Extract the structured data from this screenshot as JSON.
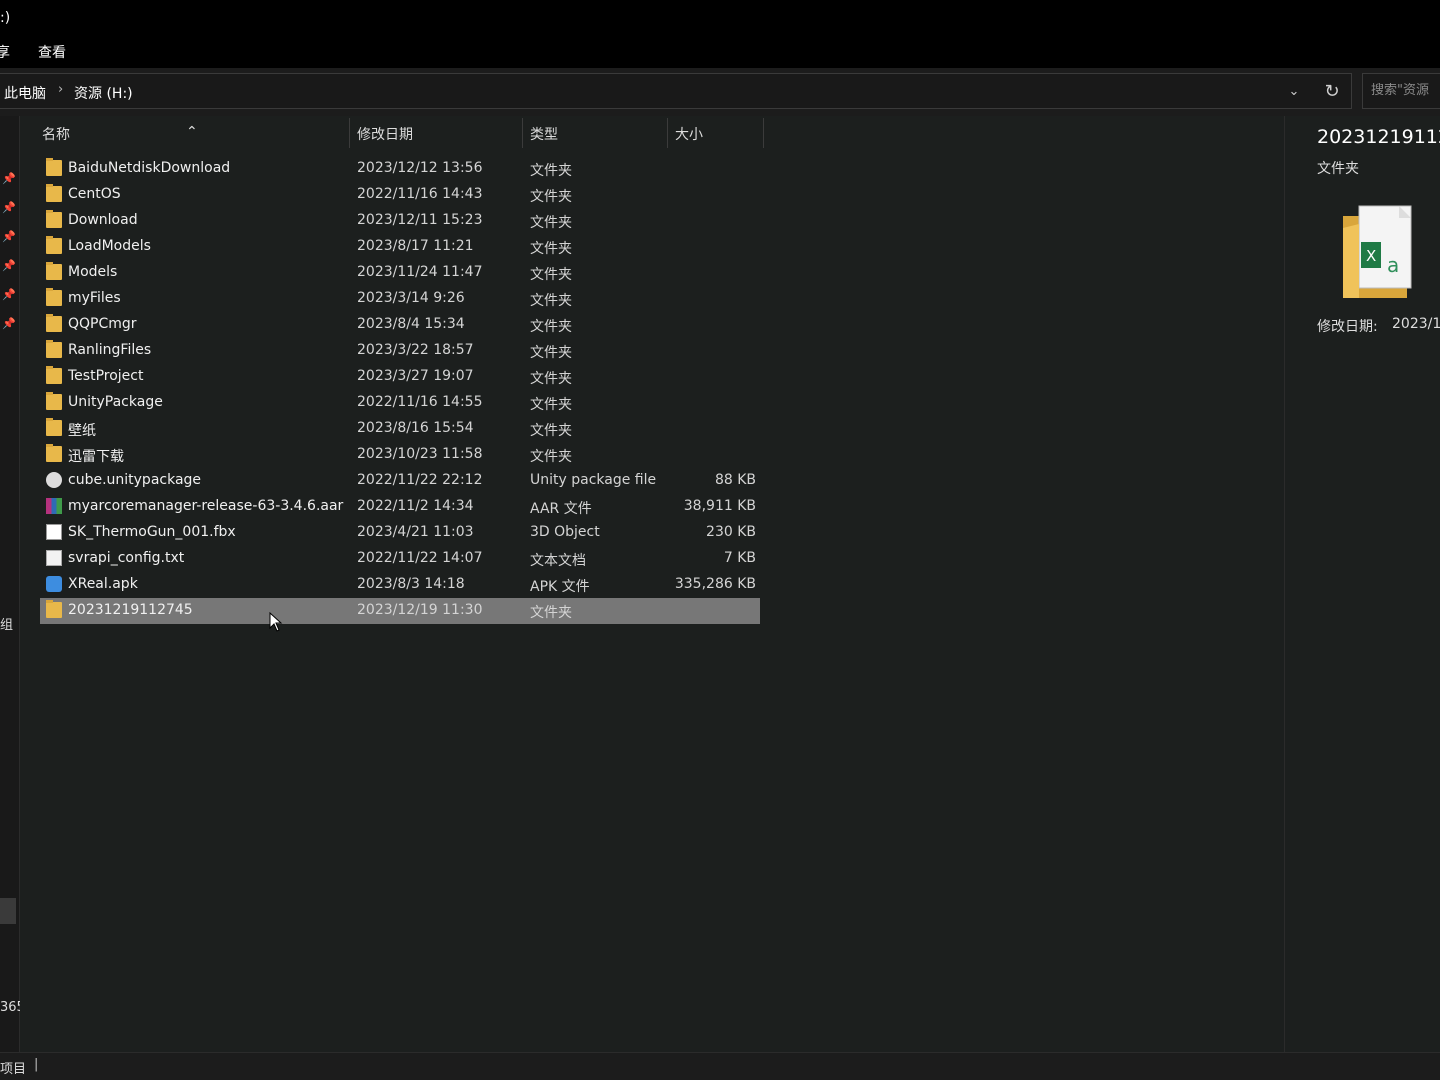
{
  "window": {
    "title": ":)"
  },
  "menu": {
    "items": [
      {
        "label": "享"
      },
      {
        "label": "查看"
      }
    ]
  },
  "address": {
    "crumbs": [
      {
        "label": "此电脑"
      },
      {
        "label": "资源 (H:)"
      }
    ],
    "separator": "›",
    "search_placeholder": "搜索\"资源"
  },
  "nav": {
    "group_label": "组",
    "count_label": "365"
  },
  "columns": {
    "name": "名称",
    "date": "修改日期",
    "type": "类型",
    "size": "大小"
  },
  "files": [
    {
      "name": "BaiduNetdiskDownload",
      "date": "2023/12/12 13:56",
      "type": "文件夹",
      "size": "",
      "icon": "folder-icon"
    },
    {
      "name": "CentOS",
      "date": "2022/11/16 14:43",
      "type": "文件夹",
      "size": "",
      "icon": "folder-icon"
    },
    {
      "name": "Download",
      "date": "2023/12/11 15:23",
      "type": "文件夹",
      "size": "",
      "icon": "folder-icon"
    },
    {
      "name": "LoadModels",
      "date": "2023/8/17 11:21",
      "type": "文件夹",
      "size": "",
      "icon": "folder-icon"
    },
    {
      "name": "Models",
      "date": "2023/11/24 11:47",
      "type": "文件夹",
      "size": "",
      "icon": "folder-icon"
    },
    {
      "name": "myFiles",
      "date": "2023/3/14 9:26",
      "type": "文件夹",
      "size": "",
      "icon": "folder-icon"
    },
    {
      "name": "QQPCmgr",
      "date": "2023/8/4 15:34",
      "type": "文件夹",
      "size": "",
      "icon": "folder-icon"
    },
    {
      "name": "RanlingFiles",
      "date": "2023/3/22 18:57",
      "type": "文件夹",
      "size": "",
      "icon": "folder-icon"
    },
    {
      "name": "TestProject",
      "date": "2023/3/27 19:07",
      "type": "文件夹",
      "size": "",
      "icon": "folder-icon"
    },
    {
      "name": "UnityPackage",
      "date": "2022/11/16 14:55",
      "type": "文件夹",
      "size": "",
      "icon": "folder-icon"
    },
    {
      "name": "壁纸",
      "date": "2023/8/16 15:54",
      "type": "文件夹",
      "size": "",
      "icon": "folder-icon"
    },
    {
      "name": "迅雷下载",
      "date": "2023/10/23 11:58",
      "type": "文件夹",
      "size": "",
      "icon": "folder-icon"
    },
    {
      "name": "cube.unitypackage",
      "date": "2022/11/22 22:12",
      "type": "Unity package file",
      "size": "88 KB",
      "icon": "unity-package-icon"
    },
    {
      "name": "myarcoremanager-release-63-3.4.6.aar",
      "date": "2022/11/2 14:34",
      "type": "AAR 文件",
      "size": "38,911 KB",
      "icon": "archive-icon"
    },
    {
      "name": "SK_ThermoGun_001.fbx",
      "date": "2023/4/21 11:03",
      "type": "3D Object",
      "size": "230 KB",
      "icon": "3d-object-icon"
    },
    {
      "name": "svrapi_config.txt",
      "date": "2022/11/22 14:07",
      "type": "文本文档",
      "size": "7 KB",
      "icon": "text-file-icon"
    },
    {
      "name": "XReal.apk",
      "date": "2023/8/3 14:18",
      "type": "APK 文件",
      "size": "335,286 KB",
      "icon": "apk-icon"
    },
    {
      "name": "20231219112745",
      "date": "2023/12/19 11:30",
      "type": "文件夹",
      "size": "",
      "icon": "folder-icon",
      "selected": true
    }
  ],
  "preview": {
    "title": "20231219112",
    "type": "文件夹",
    "meta_label": "修改日期:",
    "meta_value": "2023/1"
  },
  "status": {
    "text": "项目",
    "separator": "|"
  },
  "colors": {
    "selected_row": "#777777",
    "folder": "#e8b84a",
    "background": "#1c1f1e"
  }
}
